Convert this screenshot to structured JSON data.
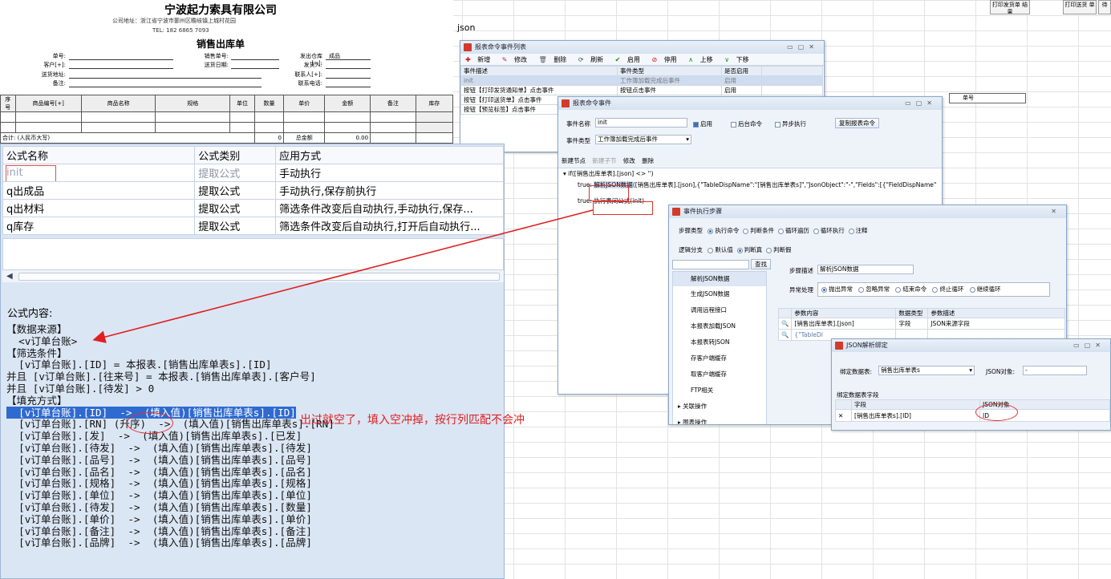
{
  "invoice": {
    "company": "宁波起力索具有限公司",
    "address": "公司地址：浙江省宁波市鄞州区瞻岐镇上城村花园",
    "tel": "TEL: 182 6865 7093",
    "title": "销售出库单",
    "labels": {
      "doc_no": "单号:",
      "customer": "客户[+]:",
      "delivery_addr": "送货地址:",
      "remark": "备注:",
      "sales_no": "销售单号:",
      "delivery_date": "送货日期:",
      "out_wh": "发出仓库[+]:",
      "shipper": "发货人:",
      "contact": "联系人[+]:",
      "phone": "联系电话:"
    },
    "out_wh_value": "成品",
    "columns": [
      "序号",
      "商品编号[+]",
      "商品名称",
      "规格",
      "单位",
      "数量",
      "单价",
      "金额",
      "备注",
      "库存"
    ],
    "total_label": "合计: (人民币大写)",
    "total_qty": "0",
    "total_amount_label": "总金额",
    "total_amount": "0.00"
  },
  "top_buttons": [
    "打印发货单 结果",
    "打印送货 单",
    "待"
  ],
  "json_cell": "json",
  "event_list_win": {
    "title": "报表命令事件列表",
    "toolbar": [
      "新增",
      "修改",
      "删除",
      "刷新",
      "启用",
      "停用",
      "上移",
      "下移"
    ],
    "columns": [
      "事件描述",
      "事件类型",
      "是否启用"
    ],
    "rows": [
      [
        "init",
        "工作簿加载完成后事件",
        "启用"
      ],
      [
        "按钮【打印发货通知单】点击事件",
        "按钮点击事件",
        "启用"
      ],
      [
        "按钮【打印送货单】点击事件",
        "",
        ""
      ],
      [
        "按钮【预览标签】点击事件",
        "",
        ""
      ]
    ]
  },
  "event_win": {
    "title": "报表命令事件",
    "name_label": "事件名称",
    "name_value": "init",
    "enable_label": "启用",
    "background_label": "后台命令",
    "async_label": "异步执行",
    "copy_btn": "复制报表命令",
    "type_label": "事件类型",
    "type_value": "工作簿加载完成后事件",
    "tabs": [
      "新建节点",
      "新建子节",
      "修改",
      "删除"
    ],
    "tree_if": "if([销售出库单表].[json] <> '')",
    "tree_true_label": "true:",
    "tree_true_action": "解析JSON数据",
    "tree_true_rest": "([销售出库单表].[json],{\"TableDispName\":\"[销售出库单表s]\",\"JsonObject\":\"-\",\"Fields\":[{\"FieldDispName\"",
    "tree_false_label": "true:",
    "tree_false_action": "执行表间公式(init)"
  },
  "step_win": {
    "title": "事件执行步骤",
    "step_types_label": "步骤类型",
    "step_types": [
      "执行命令",
      "判断条件",
      "循环遍历",
      "循环执行",
      "注释"
    ],
    "branch_label": "逻辑分支",
    "branches": [
      "默认值",
      "判断真",
      "判断假"
    ],
    "search_btn": "查找",
    "commands": [
      "解析JSON数据",
      "生成JSON数据",
      "调用远程接口",
      "本报表加载JSON",
      "本报表转JSON",
      "存客户端缓存",
      "取客户端缓存",
      "FTP相关",
      "关联操作",
      "图表操作"
    ],
    "step_desc_label": "步骤描述",
    "step_desc_value": "解析JSON数据",
    "exception_label": "异常处理",
    "exceptions": [
      "抛出异常",
      "忽略异常",
      "结束命令",
      "终止循环",
      "继续循环"
    ],
    "param_columns": [
      "参数内容",
      "数据类型",
      "参数描述"
    ],
    "param_rows": [
      [
        "[销售出库单表].[json]",
        "字段",
        "JSON来源字段"
      ],
      [
        "{\"TableDi",
        "",
        ""
      ]
    ]
  },
  "json_bind_win": {
    "title": "JSON解析绑定",
    "target_label": "绑定数据表:",
    "target_value": "销售出库单表s",
    "json_obj_label": "JSON对象:",
    "json_obj_value": "-",
    "group_label": "绑定数据表字段",
    "columns": [
      "字段",
      "JSON对象"
    ],
    "rows": [
      [
        "[销售出库单表s].[ID]",
        "ID"
      ]
    ]
  },
  "formula_panel": {
    "columns": [
      "公式名称",
      "公式类别",
      "应用方式"
    ],
    "rows": [
      [
        "init",
        "提取公式",
        "手动执行"
      ],
      [
        "q出成品",
        "提取公式",
        "手动执行,保存前执行"
      ],
      [
        "q出材料",
        "提取公式",
        "筛选条件改变后自动执行,手动执行,保存..."
      ],
      [
        "q库存",
        "提取公式",
        "筛选条件改变后自动执行,打开后自动执行..."
      ]
    ],
    "content_label": "公式内容:",
    "lines": [
      "【数据来源】",
      "  <v订单台账>",
      "【筛选条件】",
      "  [v订单台账].[ID] = 本报表.[销售出库单表s].[ID]",
      "并且 [v订单台账].[往来号] = 本报表.[销售出库单表].[客户号]",
      "并且 [v订单台账].[待发] > 0",
      "【填充方式】",
      "  [v订单台账].[ID]  ->  (填入值)[销售出库单表s].[ID]",
      "  [v订单台账].[RN] (升序)  ->  (填入值)[销售出库单表s].[RN]",
      "  [v订单台账].[发]  ->  (填入值)[销售出库单表s].[已发]",
      "  [v订单台账].[待发]  ->  (填入值)[销售出库单表s].[待发]",
      "  [v订单台账].[品号]  ->  (填入值)[销售出库单表s].[品号]",
      "  [v订单台账].[品名]  ->  (填入值)[销售出库单表s].[品名]",
      "  [v订单台账].[规格]  ->  (填入值)[销售出库单表s].[规格]",
      "  [v订单台账].[单位]  ->  (填入值)[销售出库单表s].[单位]",
      "  [v订单台账].[待发]  ->  (填入值)[销售出库单表s].[数量]",
      "  [v订单台账].[单价]  ->  (填入值)[销售出库单表s].[单价]",
      "  [v订单台账].[备注]  ->  (填入值)[销售出库单表s].[备注]",
      "  [v订单台账].[品牌]  ->  (填入值)[销售出库单表s].[品牌]"
    ]
  },
  "annotation": "出过就空了，填入空冲掉，按行列匹配不会冲",
  "right_sheet_header": "单号",
  "colors": {
    "annotation_red": "#e02020",
    "selection_blue": "#2f6ad1",
    "panel_bg": "#dbe6f4"
  }
}
